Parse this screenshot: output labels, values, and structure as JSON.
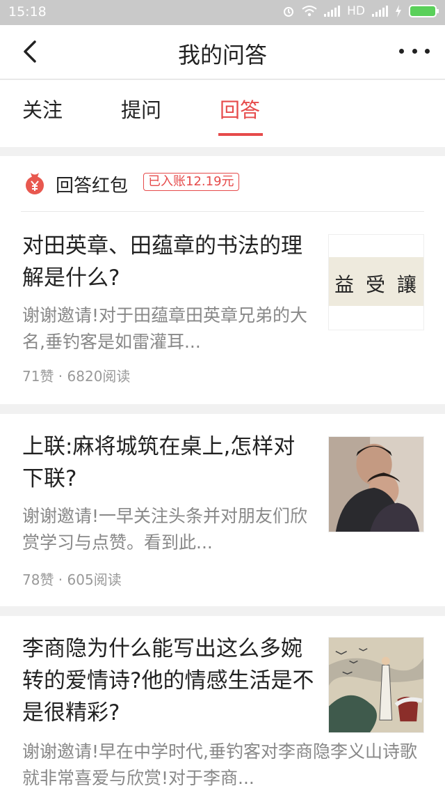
{
  "status": {
    "time": "15:18",
    "network": "HD"
  },
  "header": {
    "title": "我的问答"
  },
  "tabs": [
    {
      "label": "关注"
    },
    {
      "label": "提问"
    },
    {
      "label": "回答",
      "active": true
    }
  ],
  "redpacket": {
    "label": "回答红包",
    "badge": "已入账12.19元"
  },
  "answers": [
    {
      "title": "对田英章、田蕴章的书法的理解是什么?",
      "excerpt": "谢谢邀请!对于田蕴章田英章兄弟的大名,垂钓客是如雷灌耳...",
      "meta": "71赞 · 6820阅读",
      "thumb_text": "益 受 讓"
    },
    {
      "title": "上联:麻将城筑在桌上,怎样对下联?",
      "excerpt": "谢谢邀请!一早关注头条并对朋友们欣赏学习与点赞。看到此...",
      "meta": "78赞 · 605阅读"
    },
    {
      "title": "李商隐为什么能写出这么多婉转的爱情诗?他的情感生活是不是很精彩?",
      "excerpt": "谢谢邀请!早在中学时代,垂钓客对李商隐李义山诗歌就非常喜爱与欣赏!对于李商..."
    }
  ],
  "colors": {
    "accent": "#e64b4b",
    "status_bar": "#c9c9c9"
  }
}
